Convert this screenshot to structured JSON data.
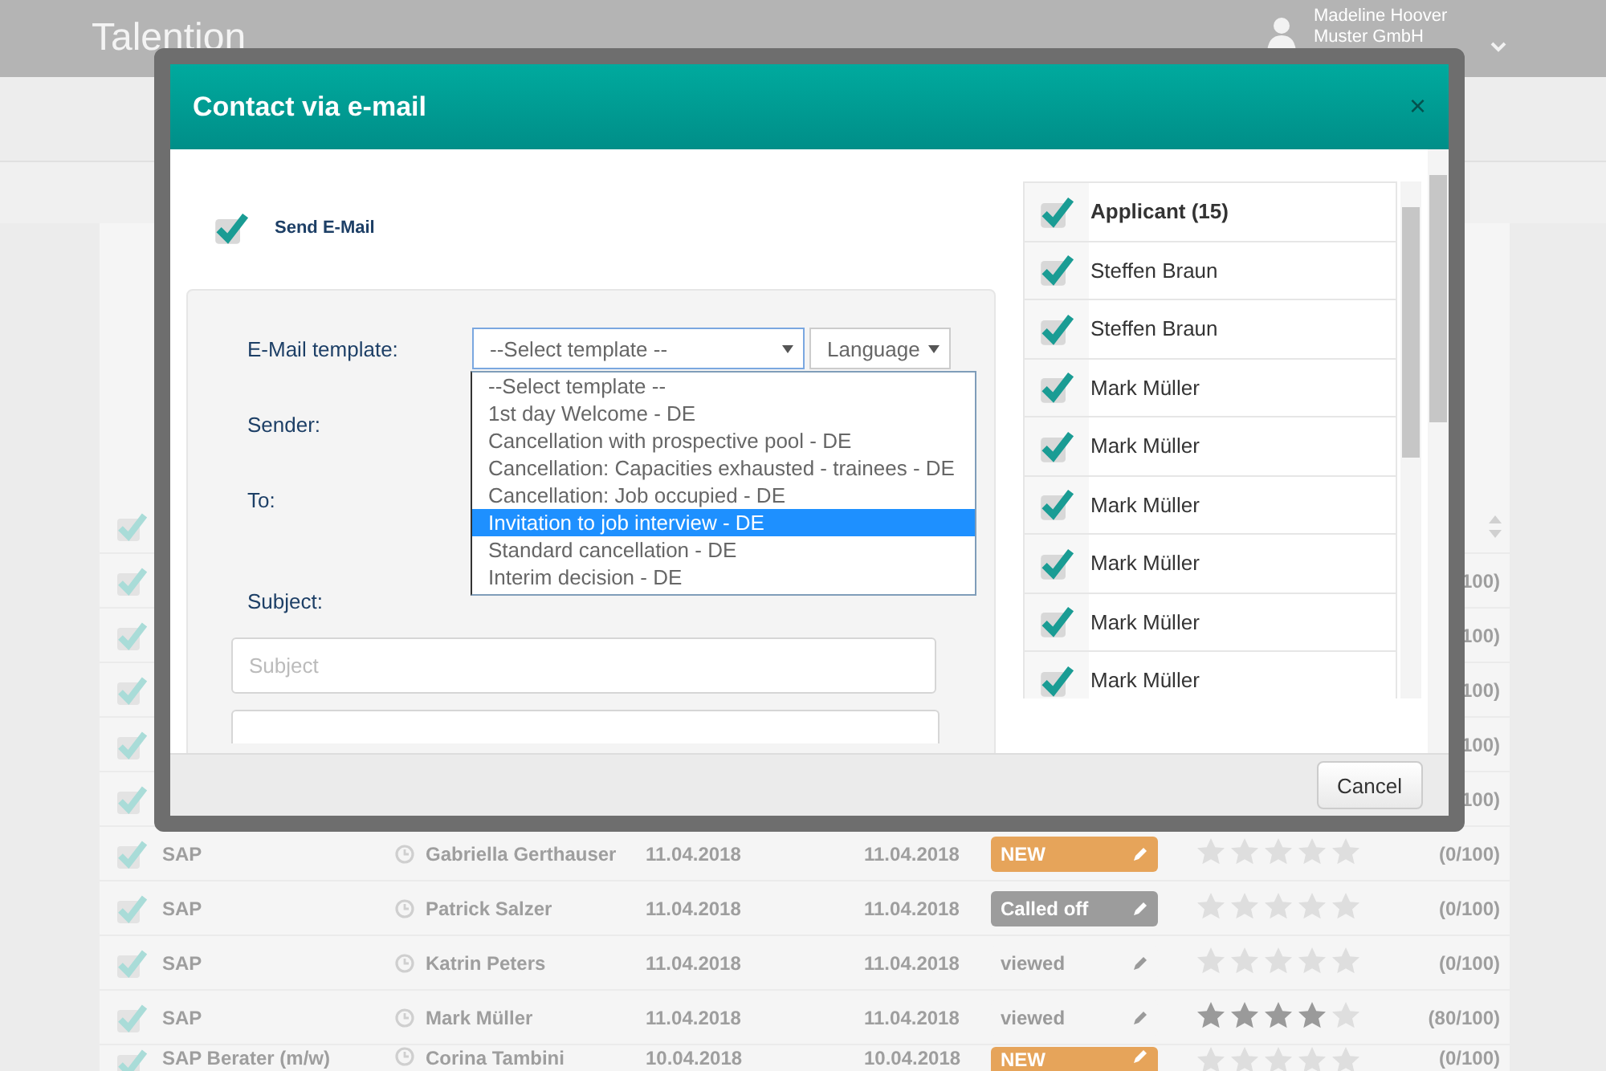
{
  "header": {
    "logo": "Talention",
    "user_name": "Madeline Hoover",
    "company": "Muster GmbH"
  },
  "table": {
    "header_checked": true,
    "rows": [
      {
        "checked": true,
        "score": "100)"
      },
      {
        "checked": true,
        "score": "100)"
      },
      {
        "checked": true,
        "score": "100)"
      },
      {
        "checked": true,
        "score": "100)"
      },
      {
        "checked": true,
        "score": "100)"
      },
      {
        "checked": true,
        "job": "SAP",
        "name": "Gabriella Gerthauser",
        "date_1": "11.04.2018",
        "date_2": "11.04.2018",
        "status": "NEW",
        "kind": "new",
        "stars": 0,
        "score": "(0/100)"
      },
      {
        "checked": true,
        "job": "SAP",
        "name": "Patrick Salzer",
        "date_1": "11.04.2018",
        "date_2": "11.04.2018",
        "status": "Called off",
        "kind": "called_off",
        "stars": 0,
        "score": "(0/100)"
      },
      {
        "checked": true,
        "job": "SAP",
        "name": "Katrin Peters",
        "date_1": "11.04.2018",
        "date_2": "11.04.2018",
        "status": "viewed",
        "kind": "viewed",
        "stars": 0,
        "score": "(0/100)"
      },
      {
        "checked": true,
        "job": "SAP",
        "name": "Mark Müller",
        "date_1": "11.04.2018",
        "date_2": "11.04.2018",
        "status": "viewed",
        "kind": "viewed",
        "stars": 4,
        "score": "(80/100)"
      },
      {
        "checked": true,
        "job": "SAP Berater (m/w)",
        "name": "Corina Tambini",
        "date_1": "10.04.2018",
        "date_2": "10.04.2018",
        "status": "NEW",
        "kind": "new",
        "stars": 0,
        "score": "(0/100)"
      }
    ]
  },
  "modal": {
    "title": "Contact via e-mail",
    "close": "×",
    "send_email": {
      "label": "Send E-Mail",
      "checked": true
    },
    "form": {
      "template_label": "E-Mail template:",
      "template_value": "--Select template --",
      "language_value": "Language",
      "sender_label": "Sender:",
      "to_label": "To:",
      "subject_label": "Subject:",
      "subject_placeholder": "Subject",
      "options": [
        {
          "label": "--Select template --",
          "selected": false
        },
        {
          "label": "1st day Welcome - DE",
          "selected": false
        },
        {
          "label": "Cancellation with prospective pool - DE",
          "selected": false
        },
        {
          "label": "Cancellation: Capacities exhausted - trainees - DE",
          "selected": false
        },
        {
          "label": "Cancellation: Job occupied - DE",
          "selected": false
        },
        {
          "label": "Invitation to job interview - DE",
          "selected": true
        },
        {
          "label": "Standard cancellation - DE",
          "selected": false
        },
        {
          "label": "Interim decision - DE",
          "selected": false
        }
      ]
    },
    "recipients": [
      {
        "name": "Applicant (15)",
        "kind": "group",
        "checked": true
      },
      {
        "name": "Steffen Braun",
        "kind": "person",
        "checked": true
      },
      {
        "name": "Steffen Braun",
        "kind": "person",
        "checked": true
      },
      {
        "name": "Mark Müller",
        "kind": "person",
        "checked": true
      },
      {
        "name": "Mark Müller",
        "kind": "person",
        "checked": true
      },
      {
        "name": "Mark Müller",
        "kind": "person",
        "checked": true
      },
      {
        "name": "Mark Müller",
        "kind": "person",
        "checked": true
      },
      {
        "name": "Mark Müller",
        "kind": "person",
        "checked": true
      },
      {
        "name": "Mark Müller",
        "kind": "person",
        "checked": true
      }
    ],
    "cancel": "Cancel"
  }
}
